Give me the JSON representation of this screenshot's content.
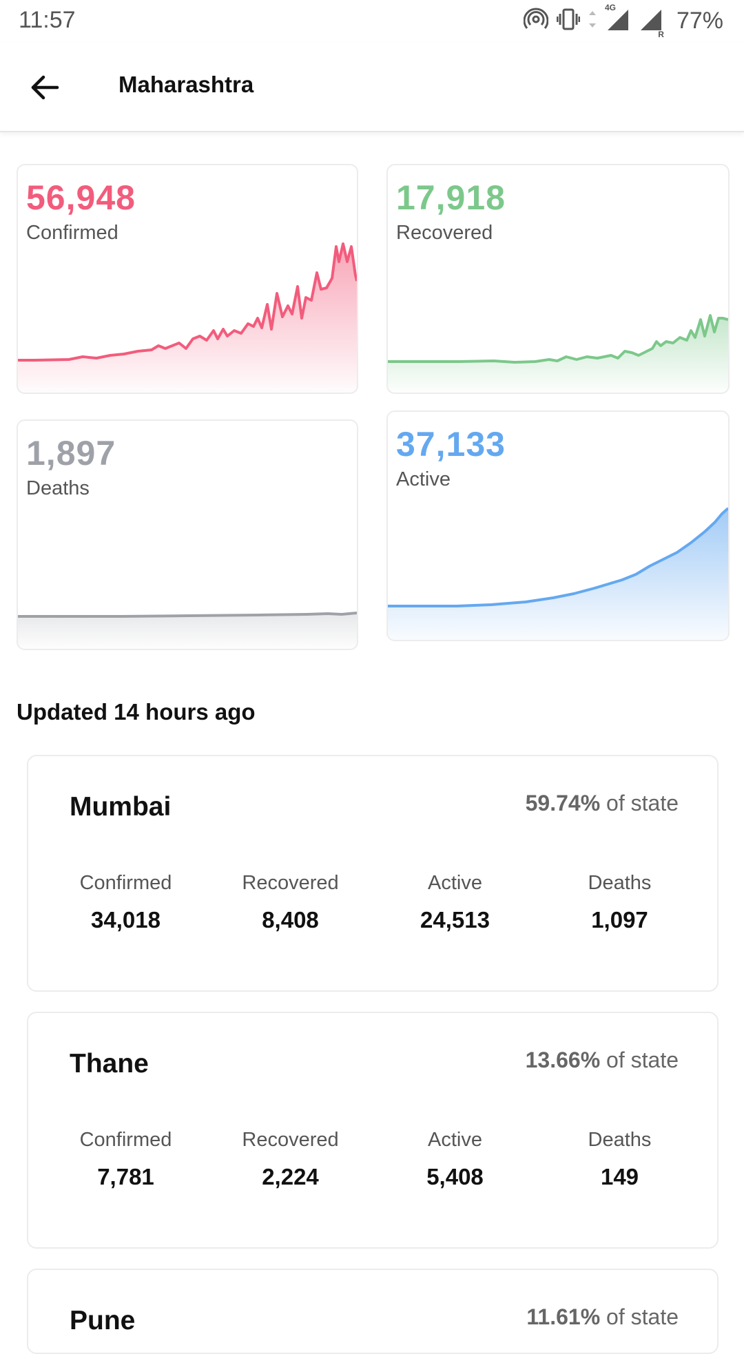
{
  "status_bar": {
    "time": "11:57",
    "battery": "77%",
    "icons": [
      "hotspot-icon",
      "vibrate-icon",
      "data-arrows-icon",
      "signal-4g-icon",
      "signal-roaming-icon"
    ],
    "network_label": "4G",
    "roaming_label": "R"
  },
  "header": {
    "title": "Maharashtra",
    "back_icon": "arrow-left-icon"
  },
  "stats": {
    "confirmed": {
      "value": "56,948",
      "label": "Confirmed",
      "color": "#f25c7c"
    },
    "recovered": {
      "value": "17,918",
      "label": "Recovered",
      "color": "#7cc88b"
    },
    "deaths": {
      "value": "1,897",
      "label": "Deaths",
      "color": "#9ea2a8"
    },
    "active": {
      "value": "37,133",
      "label": "Active",
      "color": "#64a8f0"
    }
  },
  "updated_text": "Updated 14 hours ago",
  "districts": [
    {
      "name": "Mumbai",
      "share_pct": "59.74%",
      "share_suffix": "of state",
      "stats": [
        {
          "label": "Confirmed",
          "value": "34,018"
        },
        {
          "label": "Recovered",
          "value": "8,408"
        },
        {
          "label": "Active",
          "value": "24,513"
        },
        {
          "label": "Deaths",
          "value": "1,097"
        }
      ]
    },
    {
      "name": "Thane",
      "share_pct": "13.66%",
      "share_suffix": "of state",
      "stats": [
        {
          "label": "Confirmed",
          "value": "7,781"
        },
        {
          "label": "Recovered",
          "value": "2,224"
        },
        {
          "label": "Active",
          "value": "5,408"
        },
        {
          "label": "Deaths",
          "value": "149"
        }
      ]
    },
    {
      "name": "Pune",
      "share_pct": "11.61%",
      "share_suffix": "of state"
    }
  ]
}
